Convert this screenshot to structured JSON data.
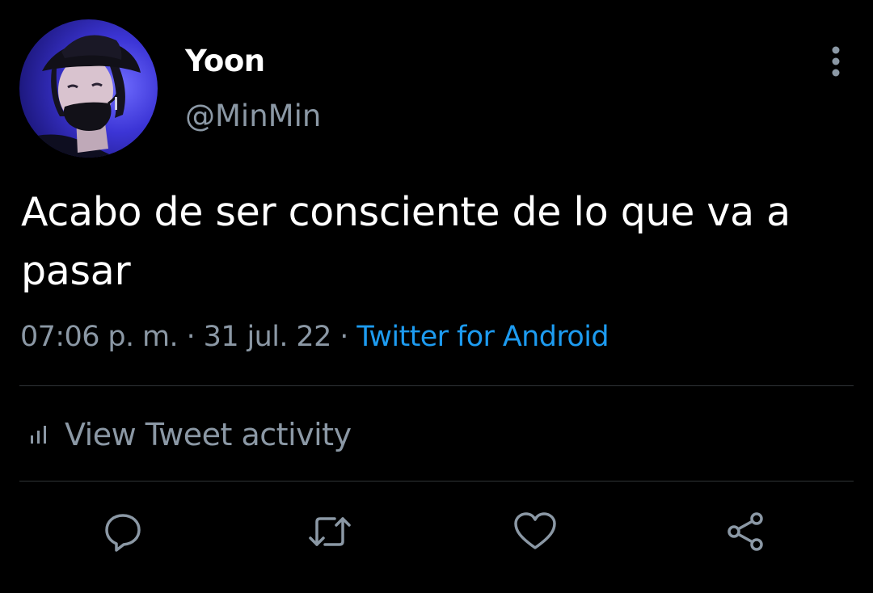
{
  "tweet": {
    "author": {
      "display_name": "Yoon",
      "handle": "@MinMin",
      "avatar_icon": "profile-photo-avatar"
    },
    "text": "Acabo de ser consciente de lo que va a pasar",
    "time": "07:06 p. m.",
    "date": "31 jul. 22",
    "separator": "·",
    "source": "Twitter for Android"
  },
  "activity": {
    "label": "View Tweet activity",
    "icon": "bar-chart-icon"
  },
  "actions": [
    {
      "name": "reply",
      "icon": "reply-bubble-icon"
    },
    {
      "name": "retweet",
      "icon": "retweet-icon"
    },
    {
      "name": "like",
      "icon": "heart-icon"
    },
    {
      "name": "share",
      "icon": "share-icon"
    }
  ],
  "menu": {
    "icon": "vertical-dots-icon"
  },
  "colors": {
    "background": "#000000",
    "primary_text": "#ffffff",
    "secondary_text": "#8b98a5",
    "accent": "#1d9bf0",
    "divider": "#2f3336",
    "avatar_bg": "#3d3ccf"
  }
}
